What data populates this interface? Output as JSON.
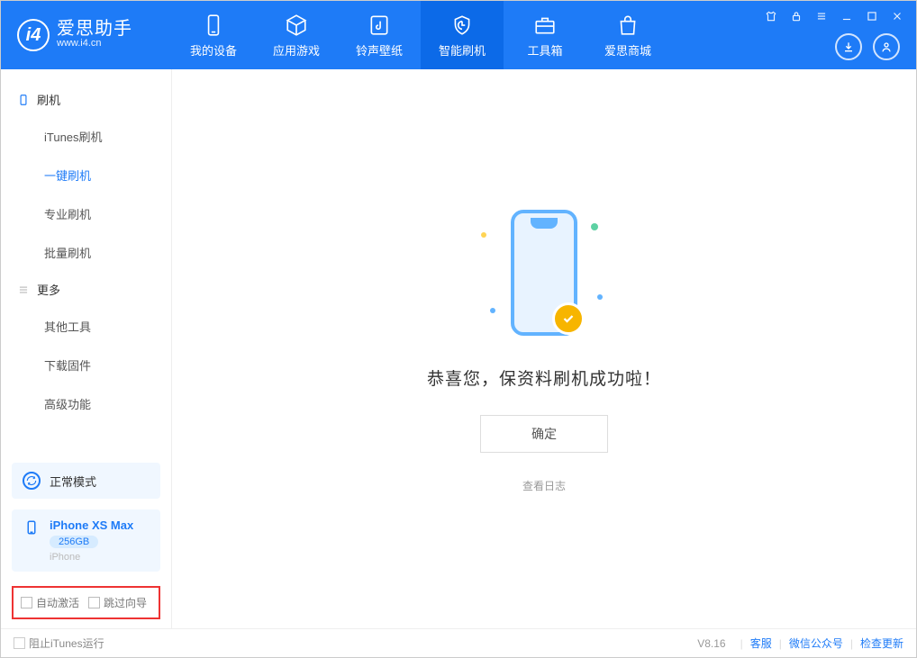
{
  "app": {
    "name": "爱思助手",
    "site": "www.i4.cn"
  },
  "nav": {
    "items": [
      {
        "label": "我的设备",
        "icon": "device"
      },
      {
        "label": "应用游戏",
        "icon": "cube"
      },
      {
        "label": "铃声壁纸",
        "icon": "music"
      },
      {
        "label": "智能刷机",
        "icon": "shield",
        "active": true
      },
      {
        "label": "工具箱",
        "icon": "toolbox"
      },
      {
        "label": "爱思商城",
        "icon": "bag"
      }
    ]
  },
  "sidebar": {
    "group1": {
      "title": "刷机",
      "items": [
        "iTunes刷机",
        "一键刷机",
        "专业刷机",
        "批量刷机"
      ],
      "activeIndex": 1
    },
    "group2": {
      "title": "更多",
      "items": [
        "其他工具",
        "下载固件",
        "高级功能"
      ]
    },
    "mode": {
      "label": "正常模式"
    },
    "device": {
      "name": "iPhone XS Max",
      "capacity": "256GB",
      "type": "iPhone"
    },
    "opts": {
      "autoActivate": "自动激活",
      "skipGuide": "跳过向导"
    }
  },
  "main": {
    "successText": "恭喜您，保资料刷机成功啦！",
    "okLabel": "确定",
    "logLink": "查看日志"
  },
  "footer": {
    "blockItunes": "阻止iTunes运行",
    "version": "V8.16",
    "links": [
      "客服",
      "微信公众号",
      "检查更新"
    ]
  }
}
